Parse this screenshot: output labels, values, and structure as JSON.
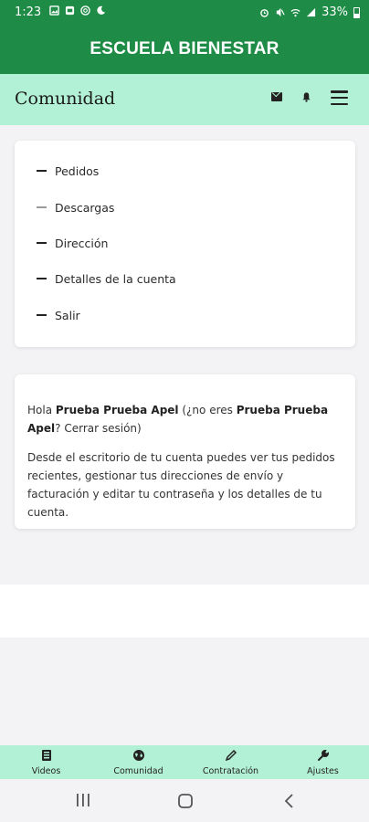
{
  "status_bar": {
    "time": "1:23",
    "battery": "33%"
  },
  "app_header": {
    "title": "ESCUELA BIENESTAR"
  },
  "sub_header": {
    "title": "Comunidad",
    "icons": [
      "mail-icon",
      "bell-icon",
      "hamburger-menu-icon"
    ]
  },
  "account_nav": {
    "items": [
      {
        "label": "Pedidos"
      },
      {
        "label": "Descargas"
      },
      {
        "label": "Dirección"
      },
      {
        "label": "Detalles de la cuenta"
      },
      {
        "label": "Salir"
      }
    ]
  },
  "greeting": {
    "hola": "Hola",
    "user": "Prueba Prueba Apel",
    "not_you": "(¿no eres",
    "user2": "Prueba Prueba Apel",
    "question": "?",
    "logout": "Cerrar sesión)",
    "description": "Desde el escritorio de tu cuenta puedes ver tus pedidos recientes, gestionar tus direcciones de envío y facturación y editar tu contraseña y los detalles de tu cuenta."
  },
  "tab_bar": {
    "tabs": [
      {
        "label": "Videos",
        "icon": "video-list-icon"
      },
      {
        "label": "Comunidad",
        "icon": "globe-icon"
      },
      {
        "label": "Contratación",
        "icon": "pencil-icon"
      },
      {
        "label": "Ajustes",
        "icon": "wrench-icon"
      }
    ]
  },
  "system_nav": {
    "buttons": [
      "recent-apps-icon",
      "home-icon",
      "back-icon"
    ]
  }
}
